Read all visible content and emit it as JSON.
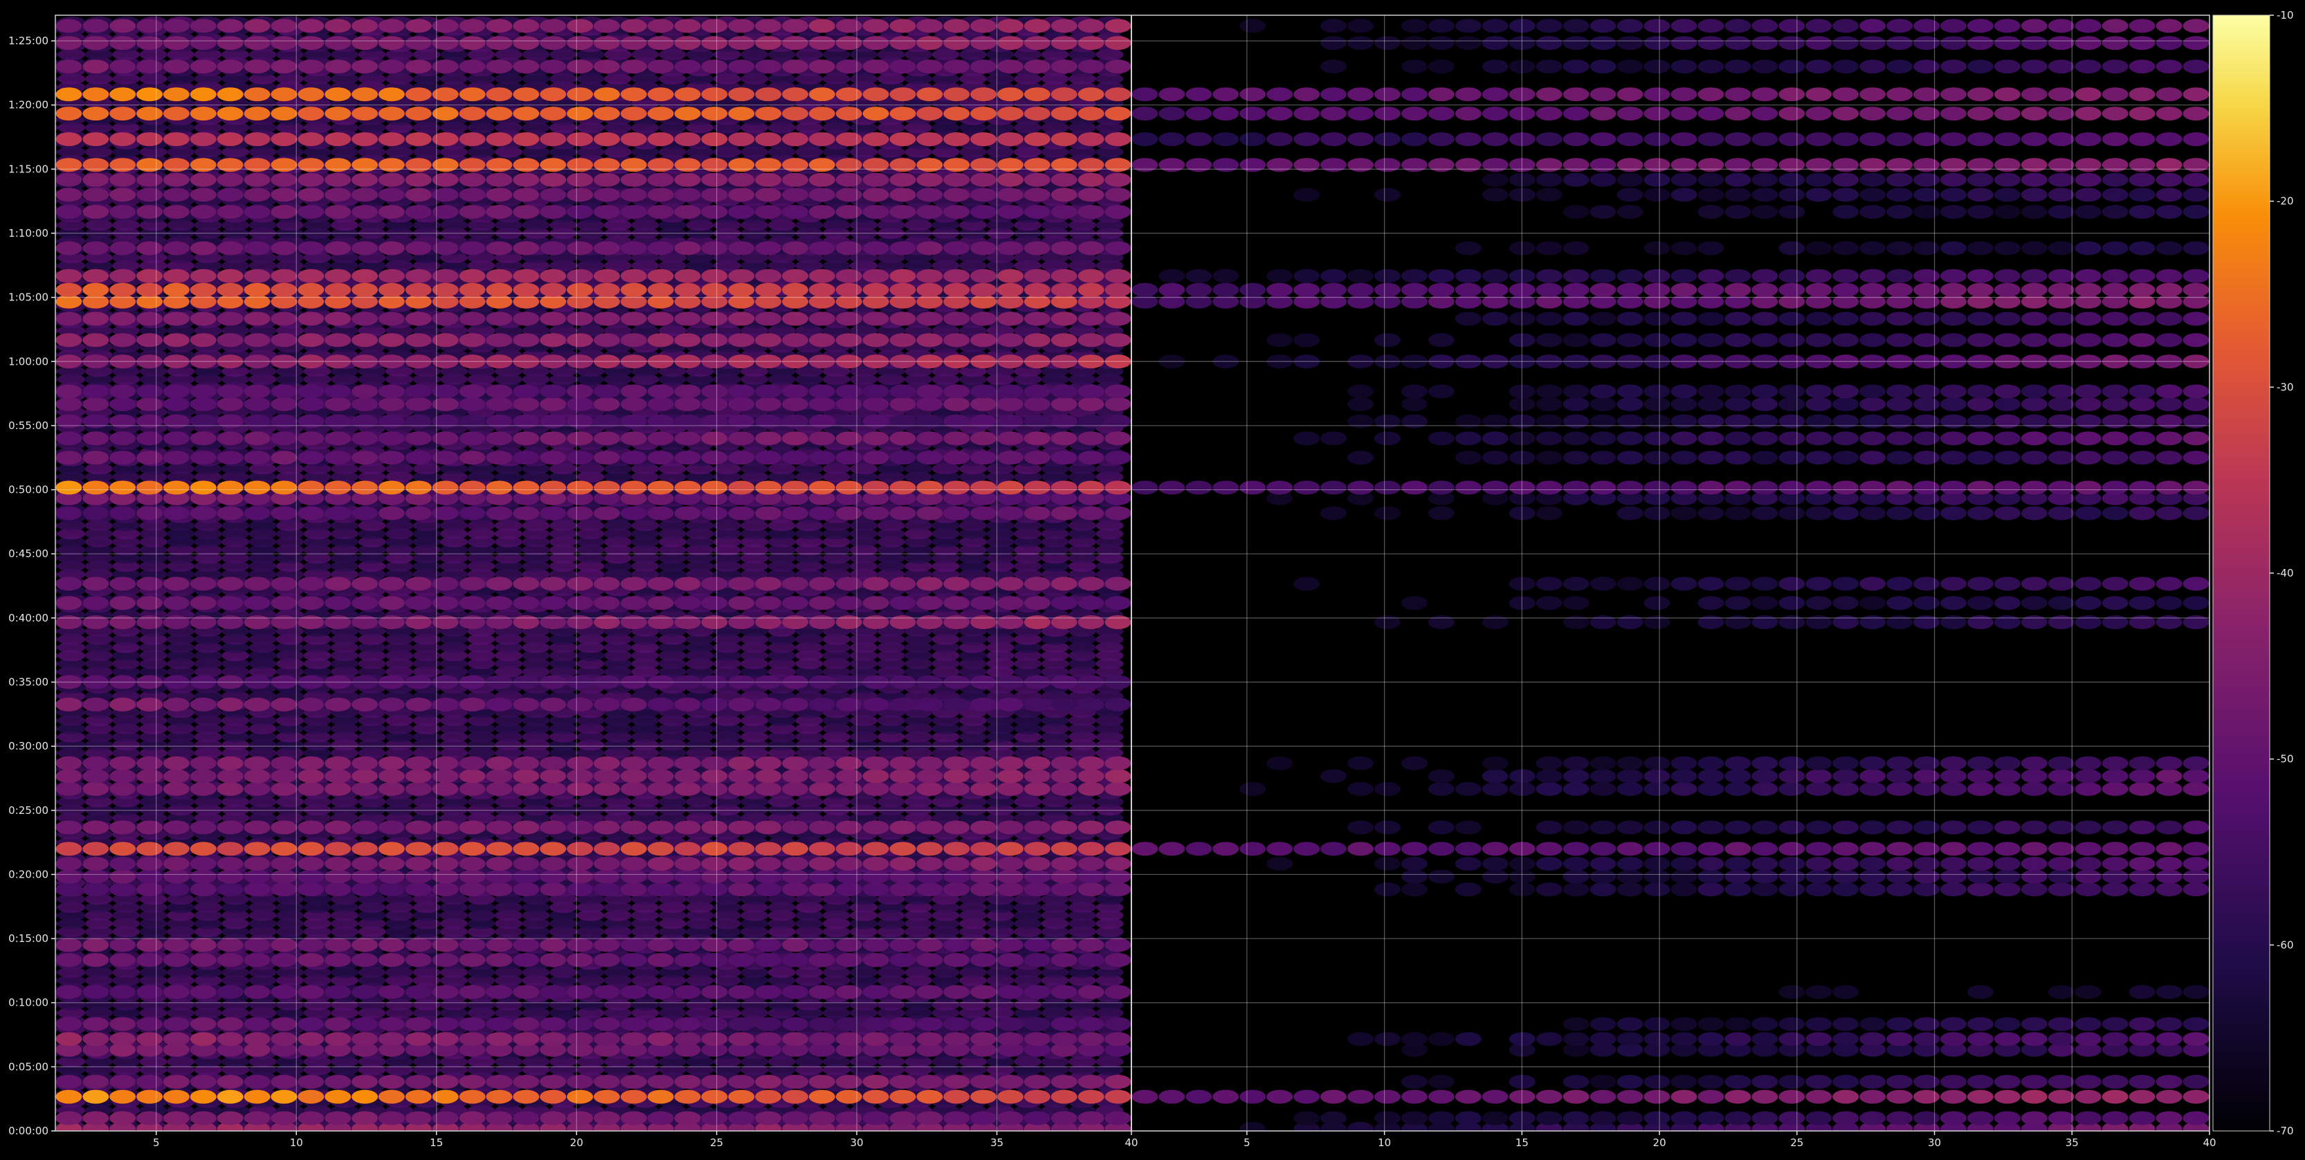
{
  "chart_data": {
    "type": "heatmap",
    "title": "",
    "xlabel": "",
    "ylabel": "",
    "panels": [
      {
        "name": "",
        "x_range": [
          1.4,
          39.8
        ],
        "x_ticks": [
          "5",
          "10",
          "15",
          "20",
          "25",
          "30",
          "35"
        ],
        "x_tick_values": [
          5,
          10,
          15,
          20,
          25,
          30,
          35
        ],
        "right_edge_label": "40"
      },
      {
        "name": "",
        "x_range": [
          0.8,
          40.0
        ],
        "x_ticks": [
          "5",
          "10",
          "15",
          "20",
          "25",
          "30",
          "35"
        ],
        "x_tick_values": [
          5,
          10,
          15,
          20,
          25,
          30,
          35
        ],
        "right_edge_label": "40"
      }
    ],
    "y_range_seconds": [
      0,
      5220
    ],
    "y_ticks": [
      "0:00:00",
      "0:05:00",
      "0:10:00",
      "0:15:00",
      "0:20:00",
      "0:25:00",
      "0:30:00",
      "0:35:00",
      "0:40:00",
      "0:45:00",
      "0:50:00",
      "0:55:00",
      "1:00:00",
      "1:05:00",
      "1:10:00",
      "1:15:00",
      "1:20:00",
      "1:25:00"
    ],
    "y_tick_values_seconds": [
      0,
      300,
      600,
      900,
      1200,
      1500,
      1800,
      2100,
      2400,
      2700,
      3000,
      3300,
      3600,
      3900,
      4200,
      4500,
      4800,
      5100
    ],
    "colorbar": {
      "min": -70,
      "max": -10,
      "ticks": [
        "-10",
        "-20",
        "-30",
        "-40",
        "-50",
        "-60",
        "-70"
      ],
      "tick_values": [
        -10,
        -20,
        -30,
        -40,
        -50,
        -60,
        -70
      ],
      "colormap": "inferno"
    },
    "bands": [
      {
        "t": 10,
        "left": [
          -40,
          -45
        ],
        "right": [
          -68,
          -45
        ]
      },
      {
        "t": 60,
        "left": [
          -45,
          -50
        ],
        "right": [
          -70,
          -50
        ]
      },
      {
        "t": 160,
        "left": [
          -20,
          -32
        ],
        "right": [
          -52,
          -40
        ]
      },
      {
        "t": 230,
        "left": [
          -48,
          -44
        ],
        "right": [
          -70,
          -55
        ]
      },
      {
        "t": 380,
        "left": [
          -45,
          -50
        ],
        "right": [
          -70,
          -55
        ]
      },
      {
        "t": 430,
        "left": [
          -42,
          -48
        ],
        "right": [
          -70,
          -52
        ]
      },
      {
        "t": 500,
        "left": [
          -48,
          -55
        ],
        "right": [
          -70,
          -58
        ]
      },
      {
        "t": 650,
        "left": [
          -52,
          -50
        ],
        "right": [
          -70,
          -66
        ]
      },
      {
        "t": 800,
        "left": [
          -48,
          -52
        ],
        "right": [
          -70,
          -70
        ]
      },
      {
        "t": 870,
        "left": [
          -46,
          -50
        ],
        "right": [
          -70,
          -70
        ]
      },
      {
        "t": 1130,
        "left": [
          -52,
          -50
        ],
        "right": [
          -70,
          -55
        ]
      },
      {
        "t": 1190,
        "left": [
          -50,
          -50
        ],
        "right": [
          -70,
          -55
        ]
      },
      {
        "t": 1250,
        "left": [
          -48,
          -44
        ],
        "right": [
          -70,
          -52
        ]
      },
      {
        "t": 1320,
        "left": [
          -30,
          -33
        ],
        "right": [
          -52,
          -50
        ]
      },
      {
        "t": 1420,
        "left": [
          -48,
          -44
        ],
        "right": [
          -70,
          -55
        ]
      },
      {
        "t": 1600,
        "left": [
          -46,
          -44
        ],
        "right": [
          -70,
          -50
        ]
      },
      {
        "t": 1660,
        "left": [
          -46,
          -42
        ],
        "right": [
          -70,
          -50
        ]
      },
      {
        "t": 1720,
        "left": [
          -46,
          -44
        ],
        "right": [
          -70,
          -55
        ]
      },
      {
        "t": 1995,
        "left": [
          -45,
          -55
        ],
        "right": [
          -70,
          -70
        ]
      },
      {
        "t": 2100,
        "left": [
          -50,
          -55
        ],
        "right": [
          -70,
          -70
        ]
      },
      {
        "t": 2380,
        "left": [
          -48,
          -40
        ],
        "right": [
          -70,
          -58
        ]
      },
      {
        "t": 2470,
        "left": [
          -48,
          -50
        ],
        "right": [
          -70,
          -60
        ]
      },
      {
        "t": 2560,
        "left": [
          -48,
          -44
        ],
        "right": [
          -70,
          -55
        ]
      },
      {
        "t": 2890,
        "left": [
          -52,
          -48
        ],
        "right": [
          -70,
          -58
        ]
      },
      {
        "t": 2960,
        "left": [
          -46,
          -50
        ],
        "right": [
          -70,
          -55
        ]
      },
      {
        "t": 3010,
        "left": [
          -22,
          -34
        ],
        "right": [
          -55,
          -50
        ]
      },
      {
        "t": 3150,
        "left": [
          -48,
          -52
        ],
        "right": [
          -70,
          -55
        ]
      },
      {
        "t": 3240,
        "left": [
          -50,
          -45
        ],
        "right": [
          -70,
          -50
        ]
      },
      {
        "t": 3320,
        "left": [
          -52,
          -55
        ],
        "right": [
          -70,
          -55
        ]
      },
      {
        "t": 3400,
        "left": [
          -50,
          -48
        ],
        "right": [
          -70,
          -55
        ]
      },
      {
        "t": 3460,
        "left": [
          -50,
          -52
        ],
        "right": [
          -70,
          -55
        ]
      },
      {
        "t": 3600,
        "left": [
          -44,
          -36
        ],
        "right": [
          -68,
          -46
        ]
      },
      {
        "t": 3700,
        "left": [
          -44,
          -42
        ],
        "right": [
          -70,
          -52
        ]
      },
      {
        "t": 3800,
        "left": [
          -46,
          -44
        ],
        "right": [
          -70,
          -54
        ]
      },
      {
        "t": 3880,
        "left": [
          -26,
          -34
        ],
        "right": [
          -55,
          -44
        ]
      },
      {
        "t": 3935,
        "left": [
          -28,
          -36
        ],
        "right": [
          -55,
          -46
        ]
      },
      {
        "t": 4000,
        "left": [
          -40,
          -40
        ],
        "right": [
          -66,
          -52
        ]
      },
      {
        "t": 4130,
        "left": [
          -48,
          -48
        ],
        "right": [
          -70,
          -62
        ]
      },
      {
        "t": 4300,
        "left": [
          -48,
          -50
        ],
        "right": [
          -70,
          -62
        ]
      },
      {
        "t": 4380,
        "left": [
          -48,
          -46
        ],
        "right": [
          -70,
          -58
        ]
      },
      {
        "t": 4450,
        "left": [
          -46,
          -42
        ],
        "right": [
          -70,
          -55
        ]
      },
      {
        "t": 4520,
        "left": [
          -26,
          -30
        ],
        "right": [
          -52,
          -42
        ]
      },
      {
        "t": 4640,
        "left": [
          -36,
          -36
        ],
        "right": [
          -60,
          -52
        ]
      },
      {
        "t": 4760,
        "left": [
          -24,
          -30
        ],
        "right": [
          -54,
          -44
        ]
      },
      {
        "t": 4850,
        "left": [
          -22,
          -32
        ],
        "right": [
          -52,
          -44
        ]
      },
      {
        "t": 4980,
        "left": [
          -46,
          -48
        ],
        "right": [
          -70,
          -55
        ]
      },
      {
        "t": 5090,
        "left": [
          -48,
          -40
        ],
        "right": [
          -70,
          -50
        ]
      },
      {
        "t": 5170,
        "left": [
          -46,
          -40
        ],
        "right": [
          -70,
          -48
        ]
      }
    ]
  }
}
